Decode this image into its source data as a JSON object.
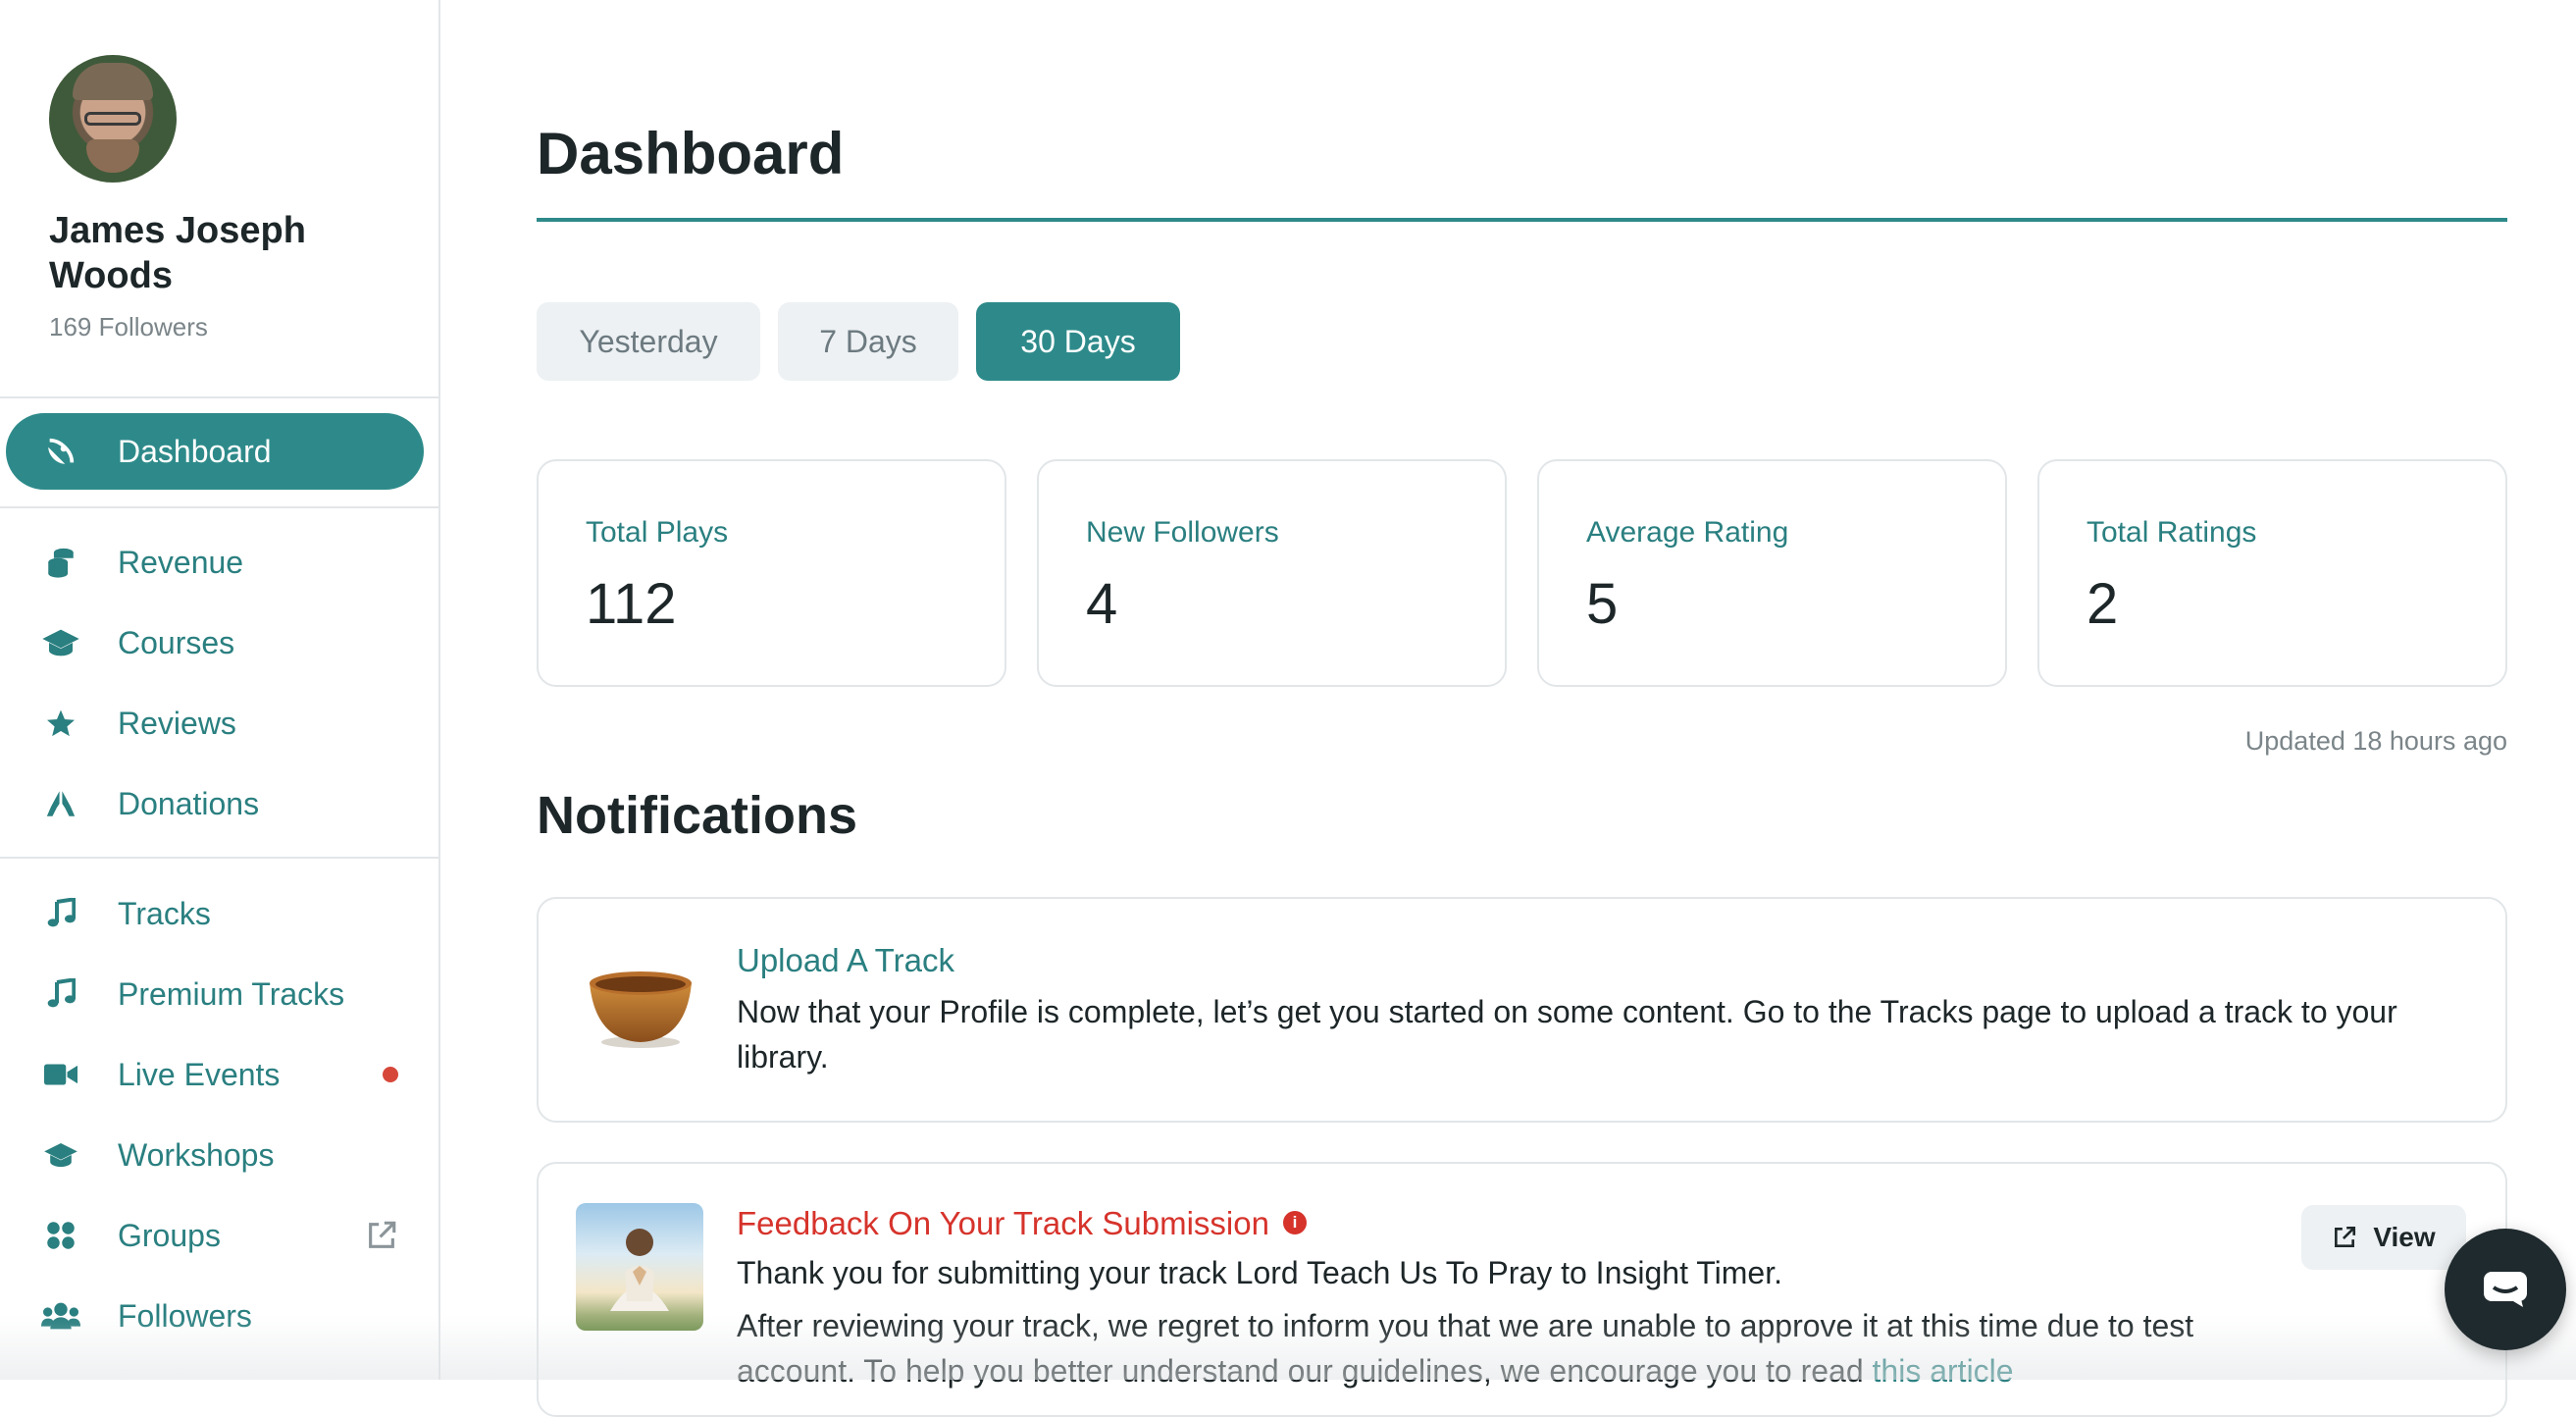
{
  "profile": {
    "name": "James Joseph Woods",
    "followers": "169 Followers"
  },
  "nav": {
    "dashboard": "Dashboard",
    "revenue": "Revenue",
    "courses": "Courses",
    "reviews": "Reviews",
    "donations": "Donations",
    "tracks": "Tracks",
    "premium_tracks": "Premium Tracks",
    "live_events": "Live Events",
    "workshops": "Workshops",
    "groups": "Groups",
    "followers": "Followers"
  },
  "header": {
    "title": "Dashboard"
  },
  "ranges": {
    "yesterday": "Yesterday",
    "seven_days": "7 Days",
    "thirty_days": "30 Days",
    "selected": "30 Days"
  },
  "stats": {
    "plays": {
      "label": "Total Plays",
      "value": "112"
    },
    "followers": {
      "label": "New Followers",
      "value": "4"
    },
    "rating": {
      "label": "Average Rating",
      "value": "5"
    },
    "ratings": {
      "label": "Total Ratings",
      "value": "2"
    },
    "updated": "Updated 18 hours ago"
  },
  "notifications": {
    "title": "Notifications",
    "upload": {
      "title": "Upload A Track",
      "body": "Now that your Profile is complete, let’s get you started on some content. Go to the Tracks page to upload a track to your library."
    },
    "feedback": {
      "title": "Feedback On Your Track Submission",
      "line1": "Thank you for submitting your track Lord Teach Us To Pray to Insight Timer.",
      "line2": "After reviewing your track, we regret to inform you that we are unable to approve it at this time due to test",
      "line3": "account. To help you better understand our guidelines, we encourage you to read",
      "link": "this article",
      "view_label": "View",
      "info_icon": "i"
    }
  },
  "colors": {
    "accent": "#2e8a8a",
    "alert": "#d6332b",
    "live_dot": "#d6473a"
  }
}
